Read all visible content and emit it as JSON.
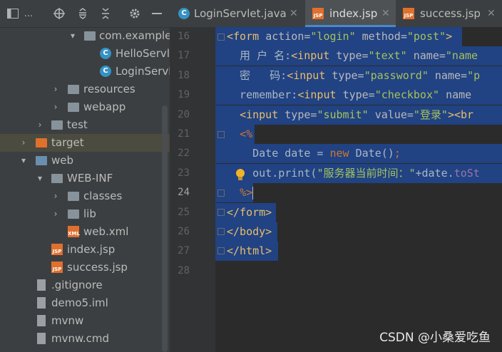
{
  "project": {
    "toolbar": {
      "title": "..."
    },
    "tree": [
      {
        "label": "com.example",
        "icon": "package-icon"
      },
      {
        "label": "HelloServl",
        "icon": "java-class-icon"
      },
      {
        "label": "LoginServl",
        "icon": "java-class-icon"
      },
      {
        "label": "resources",
        "icon": "resources-folder-icon"
      },
      {
        "label": "webapp",
        "icon": "folder-icon"
      },
      {
        "label": "test",
        "icon": "folder-icon"
      },
      {
        "label": "target",
        "icon": "excluded-folder-icon"
      },
      {
        "label": "web",
        "icon": "web-folder-icon"
      },
      {
        "label": "WEB-INF",
        "icon": "folder-icon"
      },
      {
        "label": "classes",
        "icon": "folder-icon"
      },
      {
        "label": "lib",
        "icon": "folder-icon"
      },
      {
        "label": "web.xml",
        "icon": "xml-file-icon"
      },
      {
        "label": "index.jsp",
        "icon": "jsp-file-icon"
      },
      {
        "label": "success.jsp",
        "icon": "jsp-file-icon"
      },
      {
        "label": ".gitignore",
        "icon": "gitignore-file-icon"
      },
      {
        "label": "demo5.iml",
        "icon": "iml-file-icon"
      },
      {
        "label": "mvnw",
        "icon": "file-icon"
      },
      {
        "label": "mvnw.cmd",
        "icon": "file-icon"
      }
    ]
  },
  "tabs": [
    {
      "label": "LoginServlet.java",
      "icon": "java-class-icon",
      "active": false
    },
    {
      "label": "index.jsp",
      "icon": "jsp-file-icon",
      "active": true
    },
    {
      "label": "success.jsp",
      "icon": "jsp-file-icon",
      "active": false
    }
  ],
  "editor": {
    "line_numbers": [
      "16",
      "17",
      "18",
      "19",
      "20",
      "21",
      "22",
      "23",
      "24",
      "25",
      "26",
      "27",
      "28"
    ],
    "current_line": "24",
    "lines": [
      [
        [
          "c-tag",
          "<form "
        ],
        [
          "c-attr",
          "action="
        ],
        [
          "c-str",
          "\"login\" "
        ],
        [
          "c-attr",
          "method="
        ],
        [
          "c-str",
          "\"post\""
        ],
        [
          "c-tag",
          ">"
        ]
      ],
      [
        [
          "c-txt",
          "  用 户 名:"
        ],
        [
          "c-tag",
          "<input "
        ],
        [
          "c-attr",
          "type="
        ],
        [
          "c-str",
          "\"text\" "
        ],
        [
          "c-attr",
          "name="
        ],
        [
          "c-str",
          "\"name"
        ]
      ],
      [
        [
          "c-txt",
          "  密   码:"
        ],
        [
          "c-tag",
          "<input "
        ],
        [
          "c-attr",
          "type="
        ],
        [
          "c-str",
          "\"password\" "
        ],
        [
          "c-attr",
          "name="
        ],
        [
          "c-str",
          "\"p"
        ]
      ],
      [
        [
          "c-txt",
          "  remember:"
        ],
        [
          "c-tag",
          "<input "
        ],
        [
          "c-attr",
          "type="
        ],
        [
          "c-str",
          "\"checkbox\" "
        ],
        [
          "c-attr",
          "name"
        ]
      ],
      [
        [
          "c-txt",
          "  "
        ],
        [
          "c-tag",
          "<input "
        ],
        [
          "c-attr",
          "type="
        ],
        [
          "c-str",
          "\"submit\" "
        ],
        [
          "c-attr",
          "value="
        ],
        [
          "c-str",
          "\"登录\""
        ],
        [
          "c-tag",
          "><br"
        ]
      ],
      [
        [
          "c-txt",
          "  "
        ],
        [
          "c-kw",
          "<%"
        ]
      ],
      [
        [
          "c-txt",
          "    Date date = "
        ],
        [
          "c-kw",
          "new "
        ],
        [
          "c-txt",
          "Date()"
        ],
        [
          "c-kw",
          ";"
        ]
      ],
      [
        [
          "c-txt",
          "    out.print("
        ],
        [
          "c-str",
          "\"服务器当前时间：\""
        ],
        [
          "c-txt",
          "+date."
        ],
        [
          "c-cn",
          "toSt"
        ]
      ],
      [
        [
          "c-txt",
          "  "
        ],
        [
          "c-kw",
          "%>"
        ]
      ],
      [
        [
          "c-tag",
          "</form>"
        ]
      ],
      [
        [
          "c-tag",
          "</body>"
        ]
      ],
      [
        [
          "c-tag",
          "</html>"
        ]
      ],
      []
    ]
  },
  "watermark": "CSDN @小桑爱吃鱼",
  "colors": {
    "selection": "#214283",
    "tab_underline": "#4a88c7",
    "tag": "#e8bf6a",
    "string": "#a5c25c"
  }
}
